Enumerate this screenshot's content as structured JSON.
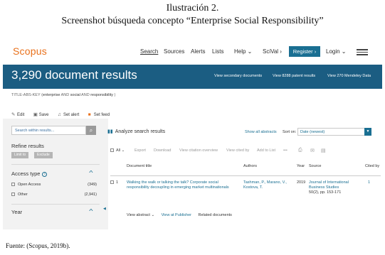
{
  "document": {
    "caption_line1": "Ilustración 2.",
    "caption_line2": "Screenshot búsqueda concepto “Enterprise Social Responsibility”",
    "source": "Fuente: (Scopus, 2019b)."
  },
  "nav": {
    "logo": "Scopus",
    "search": "Search",
    "sources": "Sources",
    "alerts": "Alerts",
    "lists": "Lists",
    "help": "Help ⌄",
    "scival": "SciVal ›",
    "register": "Register ›",
    "login": "Login ⌄"
  },
  "banner": {
    "title": "3,290 document results",
    "secondary": "View secondary documents",
    "patent": "View 8288 patent results",
    "mendeley": "View 270 Mendeley Data"
  },
  "query": {
    "prefix": "TITLE-ABS-KEY (",
    "t1": "enterprise",
    "and1": " AND ",
    "t2": "social",
    "and2": " AND ",
    "t3": "responsibility",
    "suffix": " )"
  },
  "actions": {
    "edit": "Edit",
    "save": "Save",
    "set_alert": "Set alert",
    "set_feed": "Set feed"
  },
  "sidebar": {
    "search_placeholder": "Search within results...",
    "refine": "Refine results",
    "limit_to": "Limit to",
    "exclude": "Exclude",
    "access_type": "Access type",
    "open_access": "Open Access",
    "open_access_count": "(349)",
    "other": "Other",
    "other_count": "(2,941)",
    "year": "Year"
  },
  "results": {
    "analyze": "Analyze search results",
    "show_all": "Show all abstracts",
    "sort_on": "Sort on:",
    "sort_value": "Date (newest)",
    "toolbar": {
      "all": "All ⌄",
      "export": "Export",
      "download": "Download",
      "citation_overview": "View citation overview",
      "cited_by": "View cited by",
      "add_to_list": "Add to List",
      "more": "•••"
    },
    "columns": {
      "title": "Document title",
      "authors": "Authors",
      "year": "Year",
      "source": "Source",
      "cited_by": "Cited by"
    },
    "rows": [
      {
        "num": "1",
        "title": "Walking the walk or talking the talk? Corporate social responsibility decoupling in emerging market multinationals",
        "authors": "Tashman, P., Marano, V., Kostova, T.",
        "year": "2019",
        "source": "Journal of International Business Studies",
        "source_detail": "50(2), pp. 153-171",
        "cited": "1",
        "view_abstract": "View abstract ⌄",
        "view_publisher": "View at Publisher",
        "related": "Related documents"
      }
    ]
  }
}
